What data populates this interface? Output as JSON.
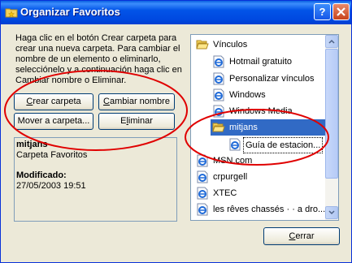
{
  "window": {
    "title": "Organizar Favoritos",
    "help_label": "?"
  },
  "instructions": "Haga clic en el botón Crear carpeta para crear una nueva carpeta. Para cambiar el nombre de un elemento o eliminarlo, selecciónelo y a continuación haga clic en Cambiar nombre o Eliminar.",
  "buttons": {
    "create_folder": {
      "access": "C",
      "rest": "rear carpeta"
    },
    "rename": {
      "access": "C",
      "rest": "ambiar nombre"
    },
    "move_prefix": "Mover a carpeta...",
    "delete": {
      "prefix": "E",
      "access": "l",
      "rest": "iminar"
    },
    "close": {
      "access": "C",
      "rest": "errar"
    }
  },
  "info": {
    "name": "mitjans",
    "type": "Carpeta Favoritos",
    "modified_label": "Modificado:",
    "modified_value": "27/05/2003 19:51"
  },
  "tree": {
    "items": [
      {
        "label": "Vínculos",
        "icon": "folder-open-icon"
      },
      {
        "label": "Hotmail gratuito",
        "icon": "ie-page-icon"
      },
      {
        "label": "Personalizar vínculos",
        "icon": "ie-page-icon"
      },
      {
        "label": "Windows",
        "icon": "ie-page-icon"
      },
      {
        "label": "Windows Media",
        "icon": "ie-page-icon"
      },
      {
        "label": "mitjans",
        "icon": "folder-open-icon"
      },
      {
        "label": "Guía de estacion...",
        "icon": "ie-page-icon"
      },
      {
        "label": "MSN.com",
        "icon": "ie-page-icon"
      },
      {
        "label": "crpurgell",
        "icon": "ie-page-icon"
      },
      {
        "label": "XTEC",
        "icon": "ie-page-icon"
      },
      {
        "label": "les rêves chassés · · a dro...",
        "icon": "ie-page-icon"
      }
    ]
  },
  "colors": {
    "selection": "#316ac5",
    "annotation_red": "#e00000",
    "titlebar": "#0054e3"
  }
}
